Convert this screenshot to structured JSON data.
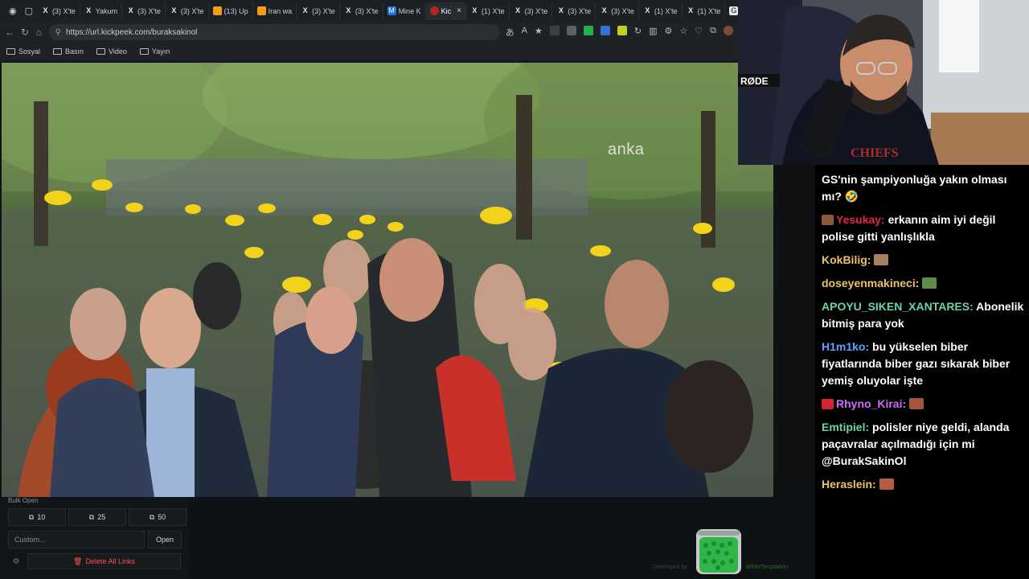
{
  "browser": {
    "tabs": [
      {
        "label": "(3) X'te",
        "icon": "x-icon"
      },
      {
        "label": "Yakum",
        "icon": "x-icon"
      },
      {
        "label": "(3) X'te",
        "icon": "x-icon"
      },
      {
        "label": "(3) X'te",
        "icon": "x-icon"
      },
      {
        "label": "(13) Up",
        "icon": "orange-icon"
      },
      {
        "label": "Iran wa",
        "icon": "orange-icon"
      },
      {
        "label": "(3) X'te",
        "icon": "x-icon"
      },
      {
        "label": "(3) X'te",
        "icon": "x-icon"
      },
      {
        "label": "Mine K",
        "icon": "blue-icon"
      },
      {
        "label": "Kic",
        "icon": "red-icon",
        "active": true
      },
      {
        "label": "(1) X'te",
        "icon": "x-icon"
      },
      {
        "label": "(3) X'te",
        "icon": "x-icon"
      },
      {
        "label": "(3) X'te",
        "icon": "x-icon"
      },
      {
        "label": "(3) X'te",
        "icon": "x-icon"
      },
      {
        "label": "(1) X'te",
        "icon": "x-icon"
      },
      {
        "label": "(1) X'te",
        "icon": "x-icon"
      },
      {
        "label": "Go",
        "icon": "white-icon"
      }
    ],
    "url": "https://url.kickpeek.com/buraksakinol",
    "bookmarks": [
      "Sosyal",
      "Basın",
      "Video",
      "Yayın"
    ]
  },
  "video": {
    "watermark": "anka"
  },
  "bulk": {
    "title": "Bulk Open",
    "buttons": [
      "10",
      "25",
      "50"
    ],
    "custom_placeholder": "Custom...",
    "open_label": "Open",
    "delete_label": "Delete All Links",
    "dev_note_left": "Developed by",
    "dev_note_right": "WhiteTemptation"
  },
  "chat": {
    "messages": [
      {
        "user": "",
        "user_color": "#ffffff",
        "text": "GS'nin şampiyonluğa yakın olması mı? 🤣",
        "emote": ""
      },
      {
        "user": "Yesukay:",
        "user_color": "#e0264a",
        "text": "erkanın aim iyi değil polise gitti yanlışlıkla",
        "badge": true
      },
      {
        "user": "KokBilig:",
        "user_color": "#efc16b",
        "text": "",
        "emote": "#a87d63"
      },
      {
        "user": "doseyenmakineci:",
        "user_color": "#efc16b",
        "text": "",
        "emote": "#5e8a4a"
      },
      {
        "user": "APOYU_SIKEN_XANTARES:",
        "user_color": "#6ad3a6",
        "text": "Abonelik bitmiş para yok"
      },
      {
        "user": "H1m1ko:",
        "user_color": "#5ba3ff",
        "text": "bu yükselen biber fiyatlarında biber gazı sıkarak biber yemiş oluyolar işte"
      },
      {
        "user": "Rhyno_Kirai:",
        "user_color": "#d16bff",
        "text": "",
        "emote": "#a5553d",
        "badge": true
      },
      {
        "user": "Emtipiel:",
        "user_color": "#6ad3a6",
        "text": "polisler niye geldi, alanda paçavralar açılmadığı için mi @BurakSakinOl"
      },
      {
        "user": "Heraslein:",
        "user_color": "#efc16b",
        "text": "",
        "emote": "#b35d44"
      }
    ]
  }
}
